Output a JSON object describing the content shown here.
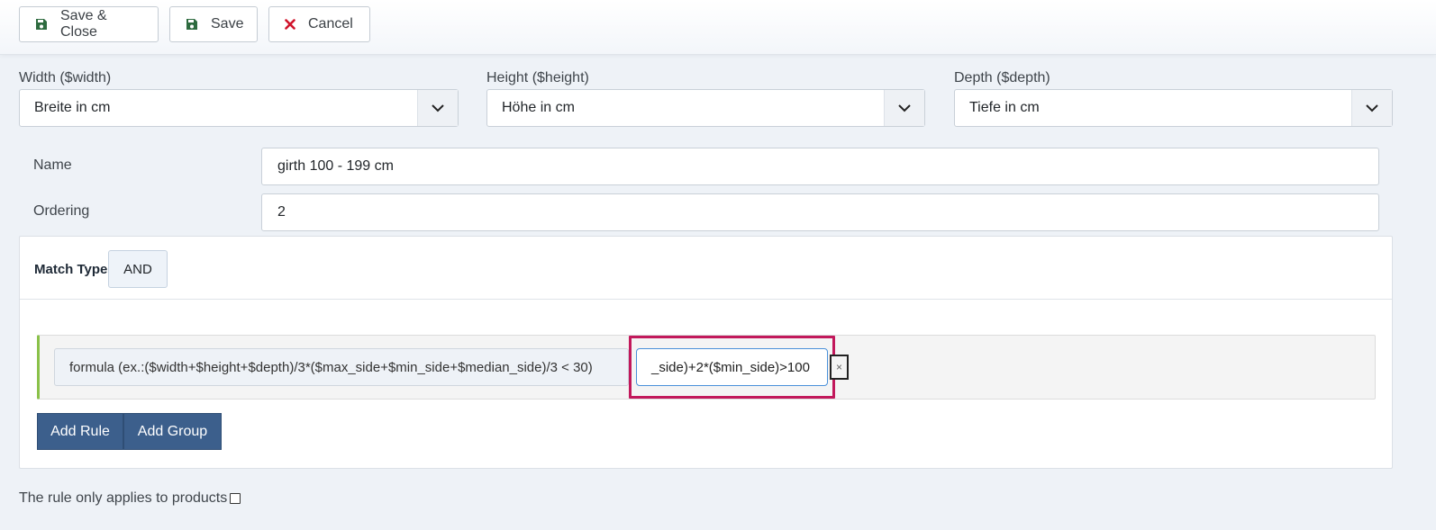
{
  "toolbar": {
    "save_close_label": "Save & Close",
    "save_label": "Save",
    "cancel_label": "Cancel",
    "save_icon_color": "#2e6b3f",
    "cancel_icon_color": "#d0142b"
  },
  "dimensions": {
    "width_label": "Width ($width)",
    "width_value": "Breite in cm",
    "height_label": "Height ($height)",
    "height_value": "Höhe in cm",
    "depth_label": "Depth ($depth)",
    "depth_value": "Tiefe in cm"
  },
  "form": {
    "name_label": "Name",
    "name_value": "girth 100 - 199 cm",
    "ordering_label": "Ordering",
    "ordering_value": "2"
  },
  "rules": {
    "match_type_label": "Match Type",
    "match_type_value": "AND",
    "filter_label": "formula (ex.:($width+$height+$depth)/3*($max_side+$min_side+$median_side)/3 < 30)",
    "formula_value": "_side)+2*($min_side)>100",
    "delete_label": "×",
    "add_rule_label": "Add Rule",
    "add_group_label": "Add Group"
  },
  "footer": {
    "applies_label": "The rule only applies to products"
  },
  "colors": {
    "accent": "#3c5f8c",
    "highlight": "#c2185b",
    "rule_border": "#8ac149"
  }
}
